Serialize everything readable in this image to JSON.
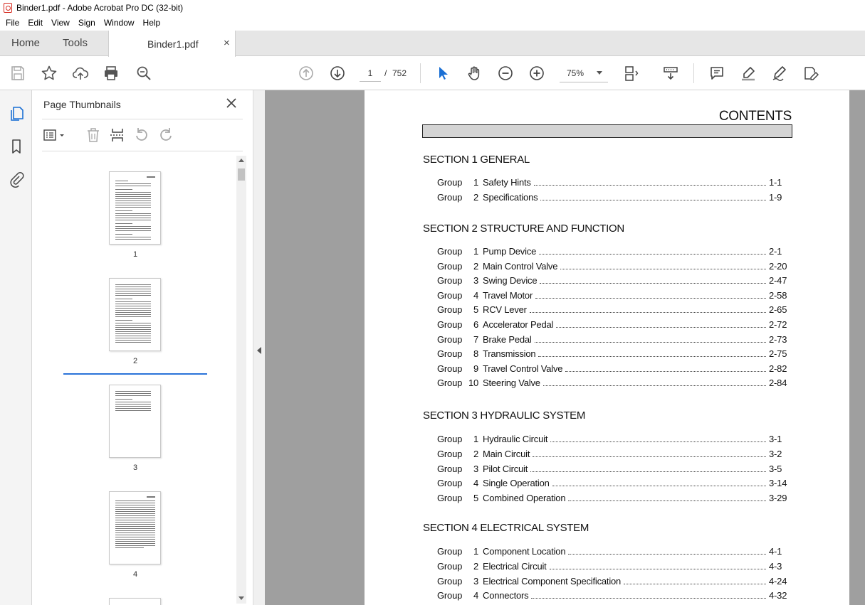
{
  "window": {
    "title": "Binder1.pdf - Adobe Acrobat Pro DC (32-bit)"
  },
  "menu": [
    "File",
    "Edit",
    "View",
    "Sign",
    "Window",
    "Help"
  ],
  "tabs": {
    "home": "Home",
    "tools": "Tools",
    "document": "Binder1.pdf",
    "close": "×"
  },
  "toolbar": {
    "page_current": "1",
    "page_sep": "/",
    "page_total": "752",
    "zoom": "75%"
  },
  "thumbnails": {
    "title": "Page Thumbnails",
    "pages": [
      "1",
      "2",
      "3",
      "4"
    ],
    "selected_page": "2"
  },
  "document": {
    "contents_title": "CONTENTS",
    "sections": [
      {
        "title": "SECTION 1  GENERAL",
        "groups": [
          {
            "group": "Group",
            "num": "1",
            "title": "Safety Hints",
            "page": "1-1"
          },
          {
            "group": "Group",
            "num": "2",
            "title": "Specifications",
            "page": "1-9"
          }
        ]
      },
      {
        "title": "SECTION 2  STRUCTURE AND FUNCTION",
        "groups": [
          {
            "group": "Group",
            "num": "1",
            "title": "Pump Device",
            "page": "2-1"
          },
          {
            "group": "Group",
            "num": "2",
            "title": "Main Control Valve",
            "page": "2-20"
          },
          {
            "group": "Group",
            "num": "3",
            "title": "Swing Device",
            "page": "2-47"
          },
          {
            "group": "Group",
            "num": "4",
            "title": "Travel Motor",
            "page": "2-58"
          },
          {
            "group": "Group",
            "num": "5",
            "title": "RCV Lever",
            "page": "2-65"
          },
          {
            "group": "Group",
            "num": "6",
            "title": "Accelerator Pedal",
            "page": "2-72"
          },
          {
            "group": "Group",
            "num": "7",
            "title": "Brake Pedal",
            "page": "2-73"
          },
          {
            "group": "Group",
            "num": "8",
            "title": "Transmission",
            "page": "2-75"
          },
          {
            "group": "Group",
            "num": "9",
            "title": "Travel Control Valve",
            "page": "2-82"
          },
          {
            "group": "Group",
            "num": "10",
            "title": "Steering Valve",
            "page": "2-84"
          }
        ]
      },
      {
        "title": "SECTION 3  HYDRAULIC SYSTEM",
        "groups": [
          {
            "group": "Group",
            "num": "1",
            "title": "Hydraulic Circuit",
            "page": "3-1"
          },
          {
            "group": "Group",
            "num": "2",
            "title": "Main Circuit",
            "page": "3-2"
          },
          {
            "group": "Group",
            "num": "3",
            "title": "Pilot Circuit",
            "page": "3-5"
          },
          {
            "group": "Group",
            "num": "4",
            "title": "Single Operation",
            "page": "3-14"
          },
          {
            "group": "Group",
            "num": "5",
            "title": "Combined Operation",
            "page": "3-29"
          }
        ]
      },
      {
        "title": "SECTION 4  ELECTRICAL SYSTEM",
        "groups": [
          {
            "group": "Group",
            "num": "1",
            "title": "Component Location",
            "page": "4-1"
          },
          {
            "group": "Group",
            "num": "2",
            "title": "Electrical Circuit",
            "page": "4-3"
          },
          {
            "group": "Group",
            "num": "3",
            "title": "Electrical Component Specification",
            "page": "4-24"
          },
          {
            "group": "Group",
            "num": "4",
            "title": "Connectors",
            "page": "4-32"
          }
        ]
      }
    ]
  },
  "colors": {
    "accent": "#2a73d9",
    "doc_background": "#9f9f9f",
    "select_tool": "#1a6fd4"
  }
}
